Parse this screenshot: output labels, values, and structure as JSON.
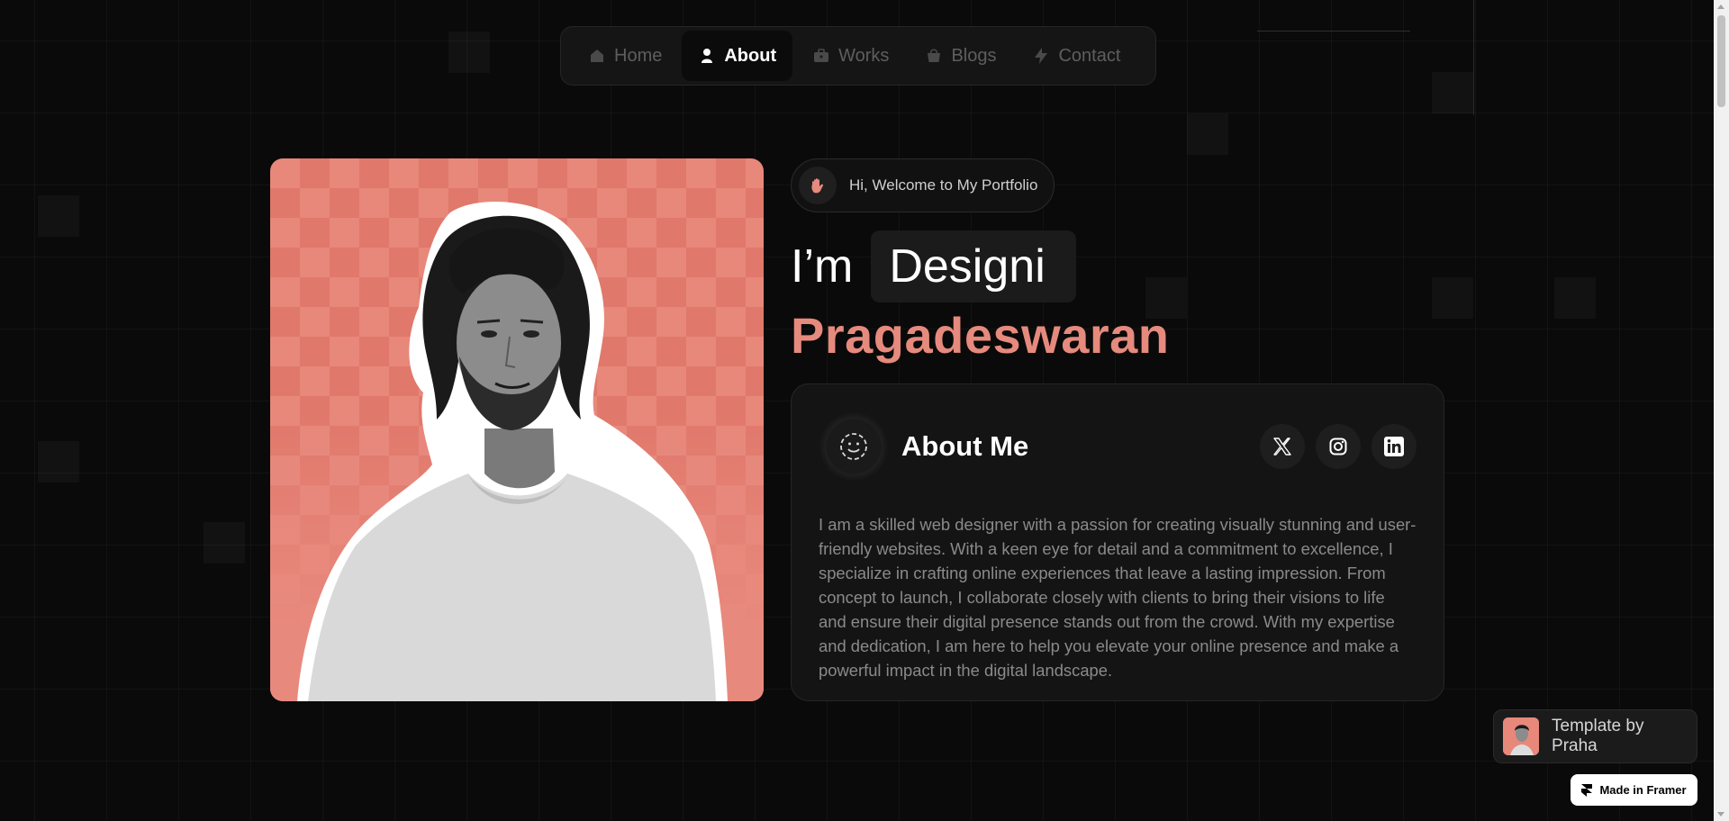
{
  "nav": {
    "items": [
      {
        "label": "Home",
        "icon": "home-icon"
      },
      {
        "label": "About",
        "icon": "user-icon"
      },
      {
        "label": "Works",
        "icon": "briefcase-icon"
      },
      {
        "label": "Blogs",
        "icon": "bag-icon"
      },
      {
        "label": "Contact",
        "icon": "bolt-icon"
      }
    ],
    "active": "About"
  },
  "hero": {
    "welcome_text": "Hi, Welcome to My Portfolio",
    "prefix": "I’m",
    "typed_role": "Designi",
    "name": "Pragadeswaran"
  },
  "about": {
    "title": "About Me",
    "socials": [
      "x-icon",
      "instagram-icon",
      "linkedin-icon"
    ],
    "body": "I am a skilled web designer with a passion for creating visually stunning and user-friendly websites. With a keen eye for detail and a commitment to excellence, I specialize in crafting online experiences that leave a lasting impression. From concept to launch, I collaborate closely with clients to bring their visions to life and ensure their digital presence stands out from the crowd. With my expertise and dedication, I am here to help you elevate your online presence and make a powerful impact in the digital landscape."
  },
  "badges": {
    "template": "Template by Praha",
    "framer": "Made in Framer"
  },
  "colors": {
    "accent": "#e58a7d",
    "background": "#0a0a0a",
    "card": "#141414"
  }
}
